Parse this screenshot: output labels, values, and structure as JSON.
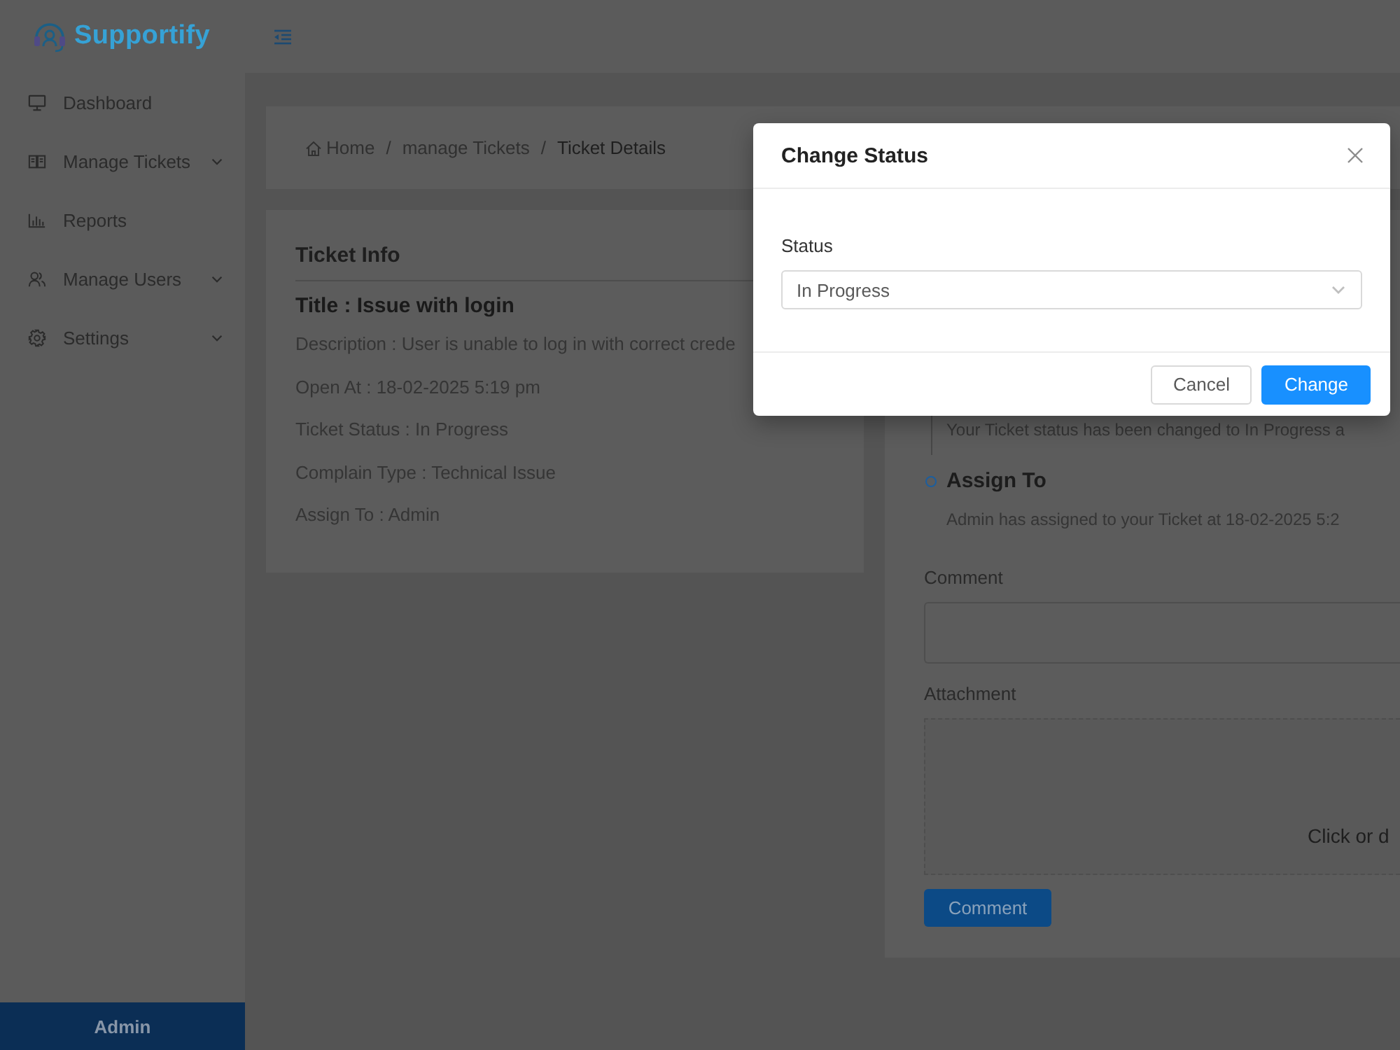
{
  "header": {
    "logo": "Supportify"
  },
  "sidebar": {
    "items": [
      {
        "label": "Dashboard",
        "kind": "link",
        "selected": false
      },
      {
        "label": "Manage Tickets",
        "kind": "submenu",
        "selected": false
      },
      {
        "label": "Reports",
        "kind": "link",
        "selected": false
      },
      {
        "label": "Manage Users",
        "kind": "submenu",
        "selected": false
      },
      {
        "label": "Settings",
        "kind": "submenu",
        "selected": false
      }
    ],
    "footer": "Admin"
  },
  "breadcrumb": [
    {
      "label": "Home",
      "current": false
    },
    {
      "separator": "/",
      "label": "manage Tickets",
      "current": false
    },
    {
      "separator": "/",
      "label": "Ticket Details",
      "current": true
    }
  ],
  "ticket_info": {
    "heading": "Ticket Info",
    "title": "Title : Issue with login",
    "fields": [
      "Description : User is unable to log in with correct crede",
      "Open At : 18-02-2025 5:19 pm",
      "Ticket Status : In Progress",
      "Complain Type : Technical Issue",
      "Assign To : Admin"
    ]
  },
  "activity": {
    "timeline": [
      {
        "kind": "continued",
        "text": "Your Ticket status has been changed to In Progress a"
      },
      {
        "kind": "event",
        "title": "Assign To",
        "text": "Admin has assigned to your Ticket at 18-02-2025 5:2"
      }
    ],
    "comment_label": "Comment",
    "attachment_label": "Attachment",
    "dropzone_text": "Click or d",
    "submit_label": "Comment"
  },
  "modal": {
    "title": "Change Status",
    "field_label": "Status",
    "value": "In Progress",
    "buttons": [
      {
        "label": "Cancel",
        "kind": "default"
      },
      {
        "label": "Change",
        "kind": "primary"
      }
    ]
  }
}
